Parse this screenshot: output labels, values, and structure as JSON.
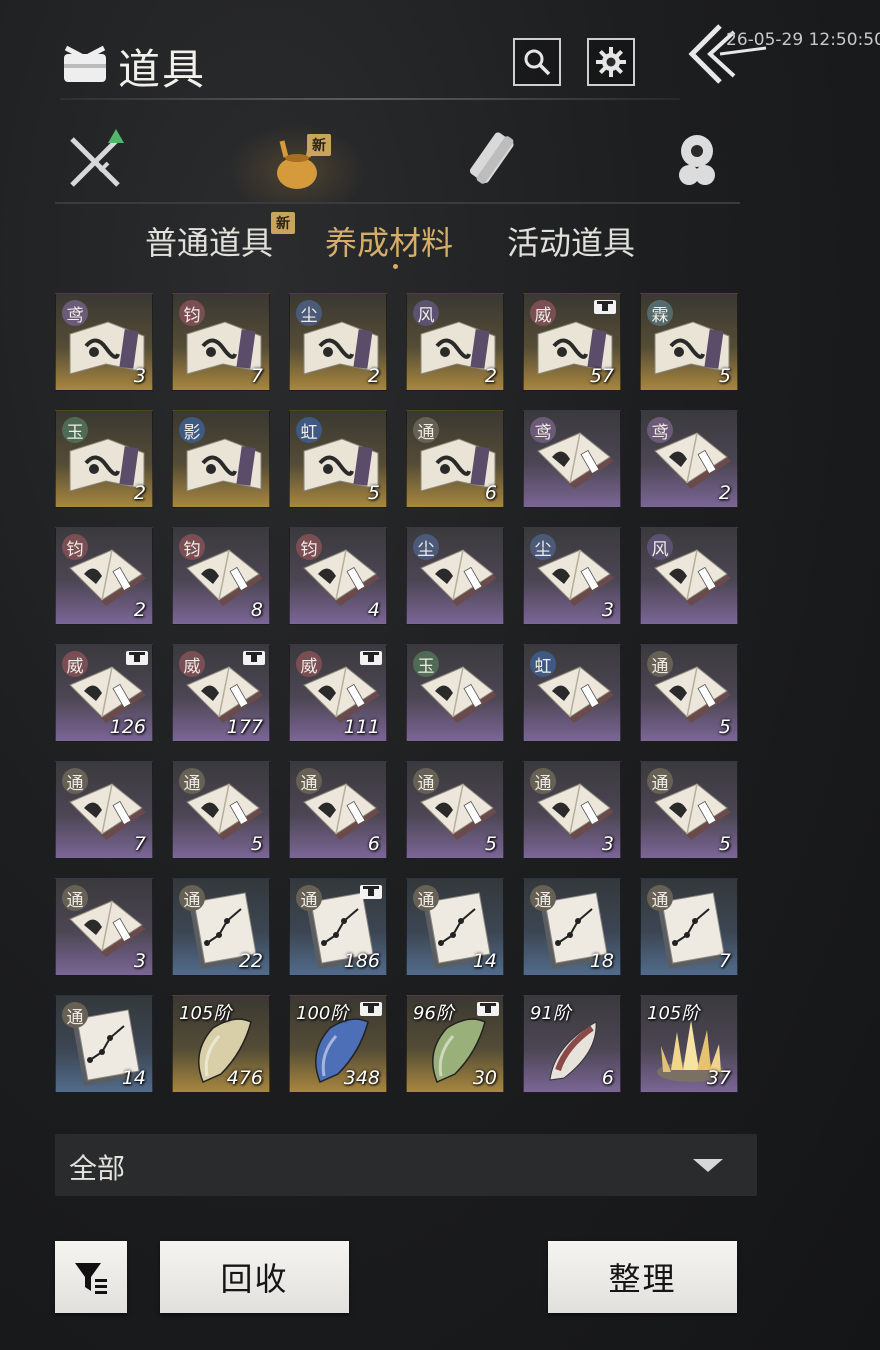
{
  "header": {
    "title": "道具",
    "timestamp": "26-05-29 12:50:50"
  },
  "category_tabs": [
    {
      "name": "weapon",
      "icon": "crossed-swords-icon",
      "active": false,
      "new": false
    },
    {
      "name": "materials-bag",
      "icon": "pouch-icon",
      "active": true,
      "new": true,
      "badge": "新"
    },
    {
      "name": "scroll",
      "icon": "scroll-icon",
      "active": false,
      "new": false
    },
    {
      "name": "token",
      "icon": "coin-stack-icon",
      "active": false,
      "new": false
    }
  ],
  "sub_tabs": {
    "tab1": "普通道具",
    "tab1_badge": "新",
    "tab2": "养成材料",
    "tab3": "活动道具",
    "active": "养成材料"
  },
  "items": [
    {
      "tag": "鸢",
      "tag_color": "#6b5a78",
      "count": "3",
      "rarity": "gold",
      "kind": "scroll-open",
      "bound": false
    },
    {
      "tag": "钧",
      "tag_color": "#7a4e52",
      "count": "7",
      "rarity": "gold",
      "kind": "scroll-open",
      "bound": false
    },
    {
      "tag": "尘",
      "tag_color": "#4c5a7a",
      "count": "2",
      "rarity": "gold",
      "kind": "scroll-open",
      "bound": false
    },
    {
      "tag": "风",
      "tag_color": "#5a5270",
      "count": "2",
      "rarity": "gold",
      "kind": "scroll-open",
      "bound": false
    },
    {
      "tag": "威",
      "tag_color": "#7a4e52",
      "count": "57",
      "rarity": "gold",
      "kind": "scroll-open",
      "bound": true
    },
    {
      "tag": "霖",
      "tag_color": "#556a6a",
      "count": "5",
      "rarity": "gold",
      "kind": "scroll-open",
      "bound": false
    },
    {
      "tag": "玉",
      "tag_color": "#4f6a55",
      "count": "2",
      "rarity": "gold",
      "kind": "scroll-open",
      "bound": false
    },
    {
      "tag": "影",
      "tag_color": "#3f5a82",
      "count": "",
      "rarity": "gold",
      "kind": "scroll-open",
      "bound": false
    },
    {
      "tag": "虹",
      "tag_color": "#3f5a82",
      "count": "5",
      "rarity": "gold",
      "kind": "scroll-open",
      "bound": false
    },
    {
      "tag": "通",
      "tag_color": "#666055",
      "count": "6",
      "rarity": "gold",
      "kind": "scroll-open",
      "bound": false
    },
    {
      "tag": "鸢",
      "tag_color": "#6b5a78",
      "count": "",
      "rarity": "purple",
      "kind": "book",
      "bound": false
    },
    {
      "tag": "鸢",
      "tag_color": "#6b5a78",
      "count": "2",
      "rarity": "purple",
      "kind": "book",
      "bound": false
    },
    {
      "tag": "钧",
      "tag_color": "#7a4e52",
      "count": "2",
      "rarity": "purple",
      "kind": "book",
      "bound": false
    },
    {
      "tag": "钧",
      "tag_color": "#7a4e52",
      "count": "8",
      "rarity": "purple",
      "kind": "book",
      "bound": false
    },
    {
      "tag": "钧",
      "tag_color": "#7a4e52",
      "count": "4",
      "rarity": "purple",
      "kind": "book",
      "bound": false
    },
    {
      "tag": "尘",
      "tag_color": "#4c5a7a",
      "count": "",
      "rarity": "purple",
      "kind": "book",
      "bound": false
    },
    {
      "tag": "尘",
      "tag_color": "#4c5a7a",
      "count": "3",
      "rarity": "purple",
      "kind": "book",
      "bound": false
    },
    {
      "tag": "风",
      "tag_color": "#5a5270",
      "count": "",
      "rarity": "purple",
      "kind": "book",
      "bound": false
    },
    {
      "tag": "威",
      "tag_color": "#7a4e52",
      "count": "126",
      "rarity": "purple",
      "kind": "book",
      "bound": true
    },
    {
      "tag": "威",
      "tag_color": "#7a4e52",
      "count": "177",
      "rarity": "purple",
      "kind": "book",
      "bound": true
    },
    {
      "tag": "威",
      "tag_color": "#7a4e52",
      "count": "111",
      "rarity": "purple",
      "kind": "book",
      "bound": true
    },
    {
      "tag": "玉",
      "tag_color": "#4f6a55",
      "count": "",
      "rarity": "purple",
      "kind": "book",
      "bound": false
    },
    {
      "tag": "虹",
      "tag_color": "#3f5a82",
      "count": "",
      "rarity": "purple",
      "kind": "book",
      "bound": false
    },
    {
      "tag": "通",
      "tag_color": "#666055",
      "count": "5",
      "rarity": "purple",
      "kind": "book",
      "bound": false
    },
    {
      "tag": "通",
      "tag_color": "#666055",
      "count": "7",
      "rarity": "purple",
      "kind": "book",
      "bound": false
    },
    {
      "tag": "通",
      "tag_color": "#666055",
      "count": "5",
      "rarity": "purple",
      "kind": "book",
      "bound": false
    },
    {
      "tag": "通",
      "tag_color": "#666055",
      "count": "6",
      "rarity": "purple",
      "kind": "book",
      "bound": false
    },
    {
      "tag": "通",
      "tag_color": "#666055",
      "count": "5",
      "rarity": "purple",
      "kind": "book",
      "bound": false
    },
    {
      "tag": "通",
      "tag_color": "#666055",
      "count": "3",
      "rarity": "purple",
      "kind": "book",
      "bound": false
    },
    {
      "tag": "通",
      "tag_color": "#666055",
      "count": "5",
      "rarity": "purple",
      "kind": "book",
      "bound": false
    },
    {
      "tag": "通",
      "tag_color": "#666055",
      "count": "3",
      "rarity": "purple",
      "kind": "book",
      "bound": false
    },
    {
      "tag": "通",
      "tag_color": "#666055",
      "count": "22",
      "rarity": "blue",
      "kind": "chart",
      "bound": false
    },
    {
      "tag": "通",
      "tag_color": "#666055",
      "count": "186",
      "rarity": "blue",
      "kind": "chart",
      "bound": true
    },
    {
      "tag": "通",
      "tag_color": "#666055",
      "count": "14",
      "rarity": "blue",
      "kind": "chart",
      "bound": false
    },
    {
      "tag": "通",
      "tag_color": "#666055",
      "count": "18",
      "rarity": "blue",
      "kind": "chart",
      "bound": false
    },
    {
      "tag": "通",
      "tag_color": "#666055",
      "count": "7",
      "rarity": "blue",
      "kind": "chart",
      "bound": false
    },
    {
      "tag": "通",
      "tag_color": "#666055",
      "count": "14",
      "rarity": "blue",
      "kind": "chart",
      "bound": false
    },
    {
      "level": "105阶",
      "count": "476",
      "rarity": "gold",
      "kind": "shard",
      "shard_color": "#d8cfa8",
      "bound": false
    },
    {
      "level": "100阶",
      "count": "348",
      "rarity": "gold",
      "kind": "shard",
      "shard_color": "#4d6fb8",
      "bound": true
    },
    {
      "level": "96阶",
      "count": "30",
      "rarity": "gold",
      "kind": "shard",
      "shard_color": "#9ab07a",
      "bound": true
    },
    {
      "level": "91阶",
      "count": "6",
      "rarity": "purple",
      "kind": "feather",
      "shard_color": "#8a4a4a",
      "bound": false
    },
    {
      "level": "105阶",
      "count": "37",
      "rarity": "purple",
      "kind": "crystal",
      "shard_color": "#e2c27a",
      "bound": false
    }
  ],
  "filter": {
    "label": "全部"
  },
  "buttons": {
    "recycle": "回收",
    "sort": "整理"
  }
}
